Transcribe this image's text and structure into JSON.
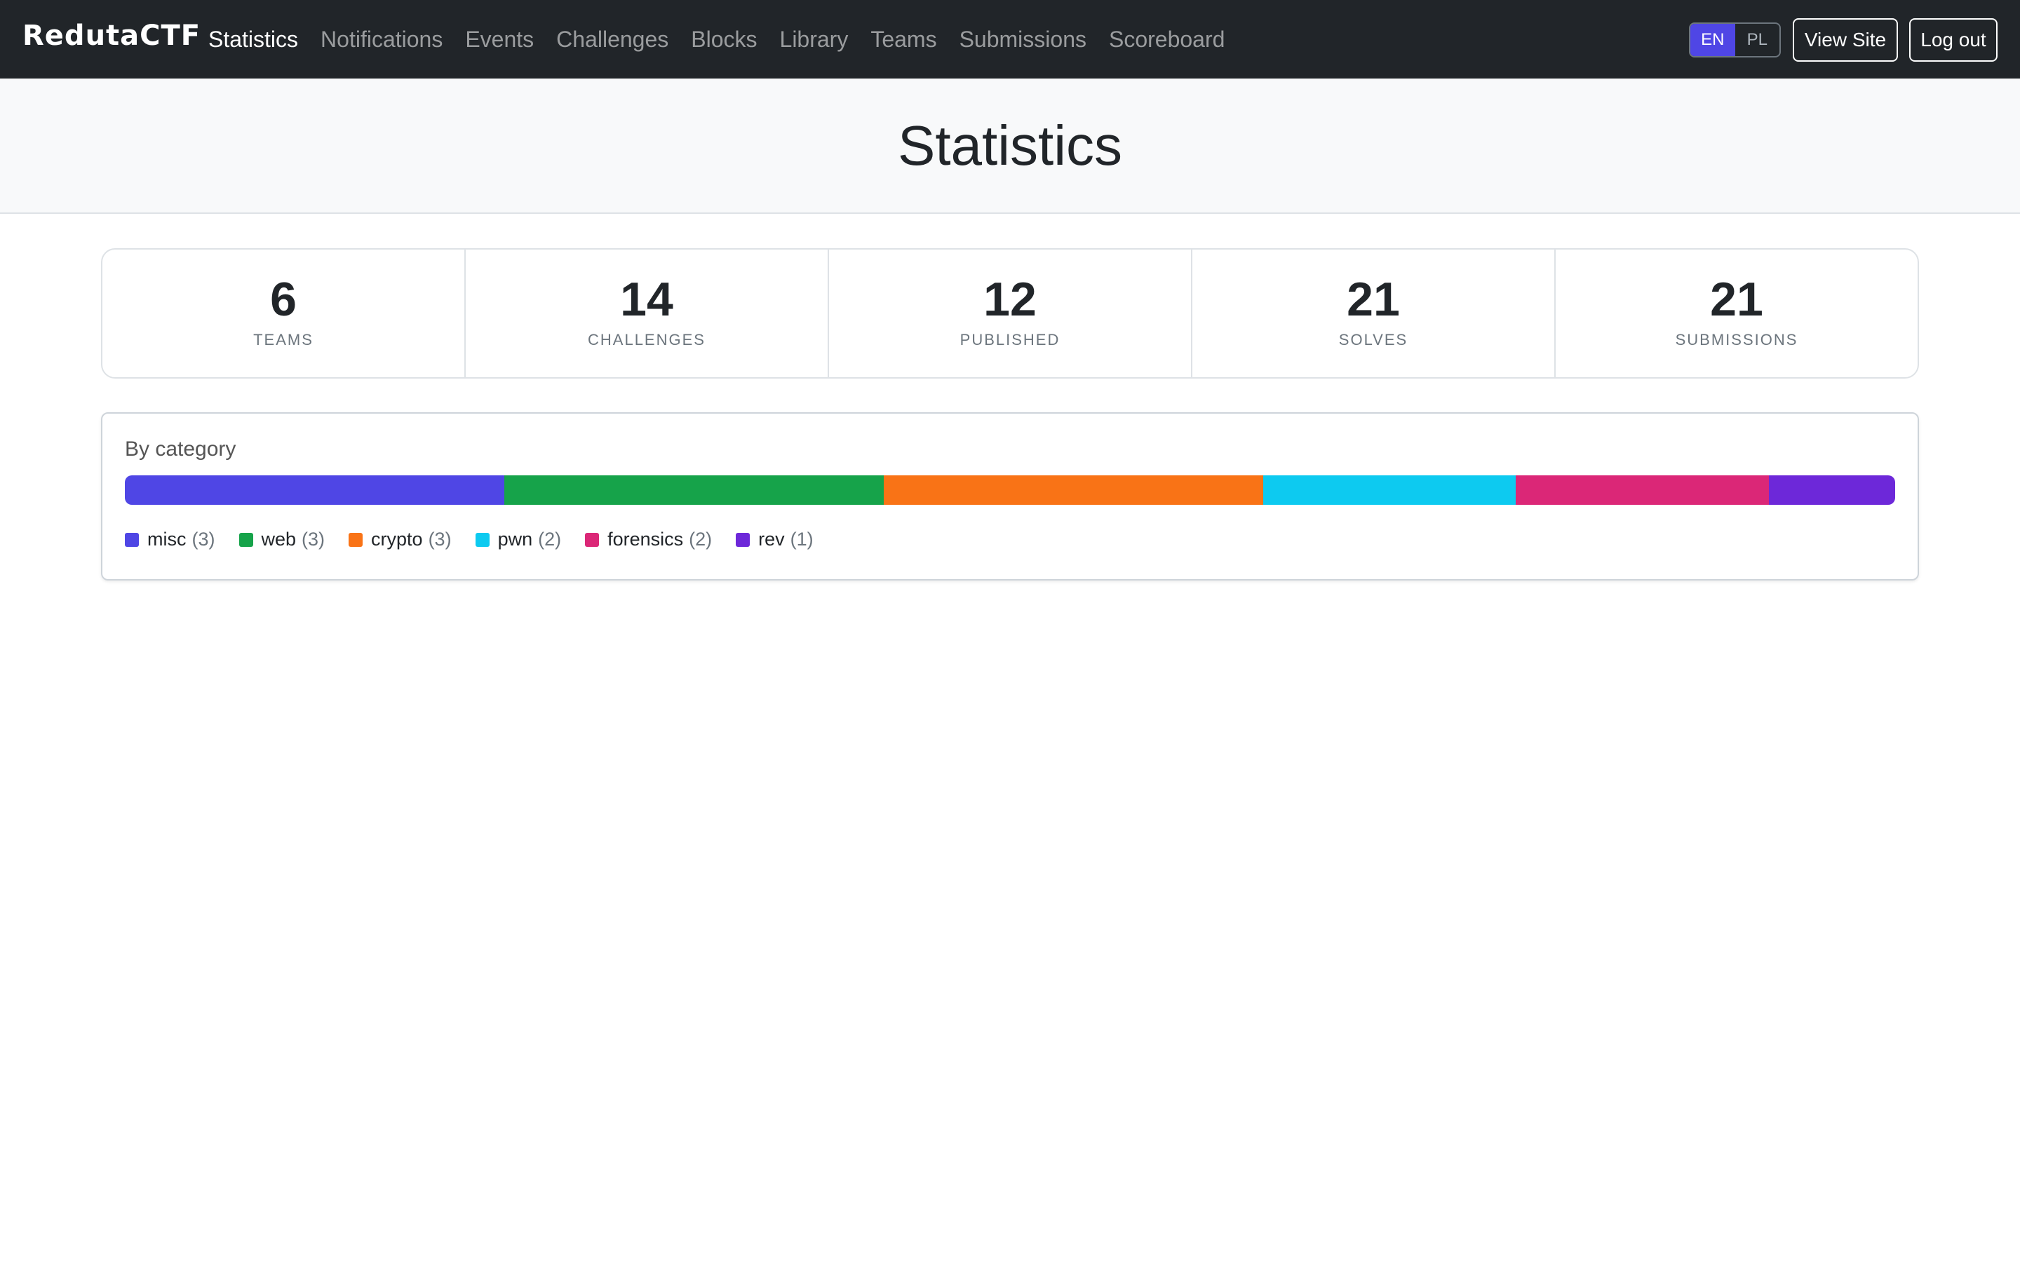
{
  "navbar": {
    "brand": "RedutaCTF",
    "links": [
      {
        "label": "Statistics",
        "active": true
      },
      {
        "label": "Notifications"
      },
      {
        "label": "Events"
      },
      {
        "label": "Challenges"
      },
      {
        "label": "Blocks"
      },
      {
        "label": "Library"
      },
      {
        "label": "Teams"
      },
      {
        "label": "Submissions"
      },
      {
        "label": "Scoreboard"
      }
    ],
    "lang": {
      "en": "EN",
      "pl": "PL",
      "selected": "EN"
    },
    "view_site": "View Site",
    "logout": "Log out"
  },
  "page": {
    "title": "Statistics"
  },
  "stats": [
    {
      "value": "6",
      "label": "TEAMS"
    },
    {
      "value": "14",
      "label": "CHALLENGES"
    },
    {
      "value": "12",
      "label": "PUBLISHED"
    },
    {
      "value": "21",
      "label": "SOLVES"
    },
    {
      "value": "21",
      "label": "SUBMISSIONS"
    }
  ],
  "by_category": {
    "title": "By category",
    "items": [
      {
        "name": "misc",
        "count": 3,
        "count_label": "(3)",
        "color": "#4f46e5"
      },
      {
        "name": "web",
        "count": 3,
        "count_label": "(3)",
        "color": "#16a34a"
      },
      {
        "name": "crypto",
        "count": 3,
        "count_label": "(3)",
        "color": "#f97316"
      },
      {
        "name": "pwn",
        "count": 2,
        "count_label": "(2)",
        "color": "#0dcaf0"
      },
      {
        "name": "forensics",
        "count": 2,
        "count_label": "(2)",
        "color": "#db2777"
      },
      {
        "name": "rev",
        "count": 1,
        "count_label": "(1)",
        "color": "#6d28d9"
      }
    ]
  }
}
